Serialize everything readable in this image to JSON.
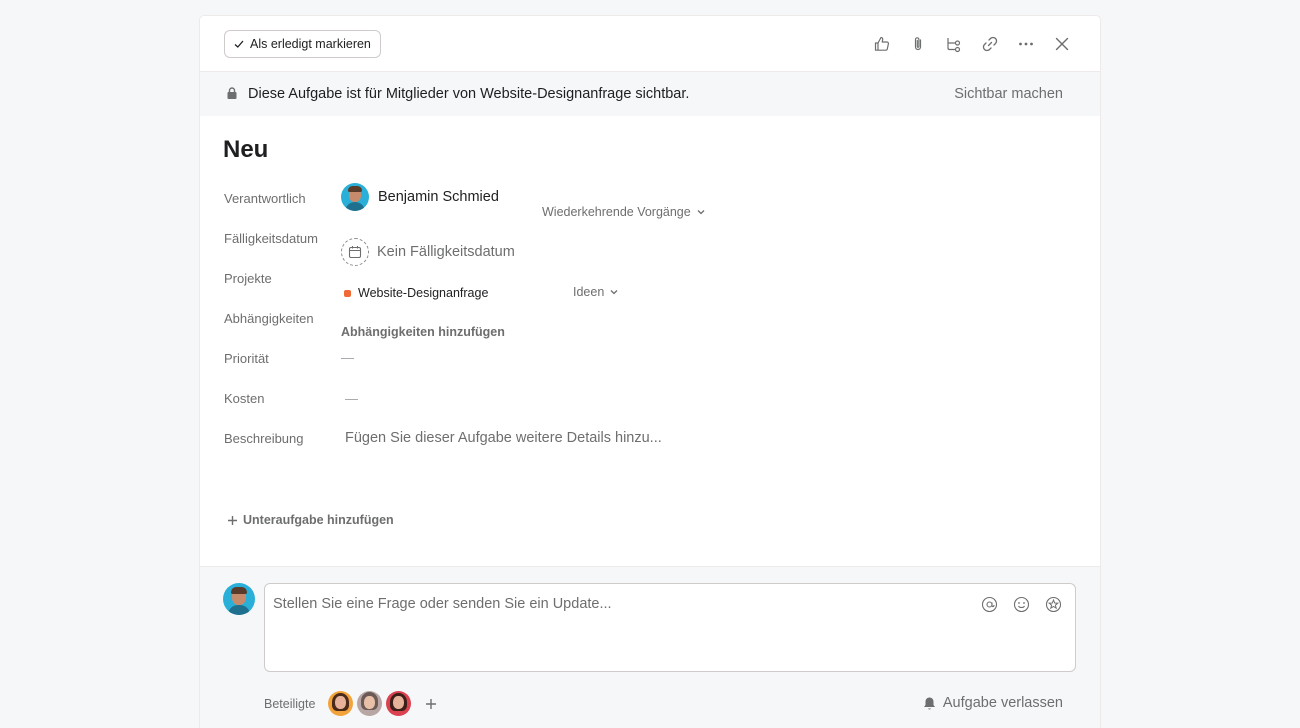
{
  "toolbar": {
    "complete_label": "Als erledigt markieren",
    "icons": [
      "thumbs-up-icon",
      "paperclip-icon",
      "subtask-icon",
      "link-icon",
      "more-icon",
      "close-icon"
    ]
  },
  "banner": {
    "text": "Diese Aufgabe ist für Mitglieder von Website-Designanfrage sichtbar.",
    "action": "Sichtbar machen"
  },
  "task": {
    "title": "Neu"
  },
  "fields": {
    "assignee": {
      "label": "Verantwortlich",
      "value": "Benjamin Schmied",
      "recurring": "Wiederkehrende Vorgänge"
    },
    "due_date": {
      "label": "Fälligkeitsdatum",
      "value": "Kein Fälligkeitsdatum"
    },
    "projects": {
      "label": "Projekte",
      "project": "Website-Designanfrage",
      "project_color": "#f06a35",
      "section": "Ideen"
    },
    "dependencies": {
      "label": "Abhängigkeiten",
      "action": "Abhängigkeiten hinzufügen"
    },
    "priority": {
      "label": "Priorität",
      "value": "—"
    },
    "cost": {
      "label": "Kosten",
      "value": "—"
    },
    "description": {
      "label": "Beschreibung",
      "placeholder": "Fügen Sie dieser Aufgabe weitere Details hinzu..."
    }
  },
  "subtask": {
    "label": "Unteraufgabe hinzufügen"
  },
  "comment": {
    "placeholder": "Stellen Sie eine Frage oder senden Sie ein Update...",
    "collaborators_label": "Beteiligte",
    "leave_label": "Aufgabe verlassen"
  },
  "colors": {
    "accent_project": "#f06a35",
    "avatar_bg": "#2ab0d8"
  }
}
